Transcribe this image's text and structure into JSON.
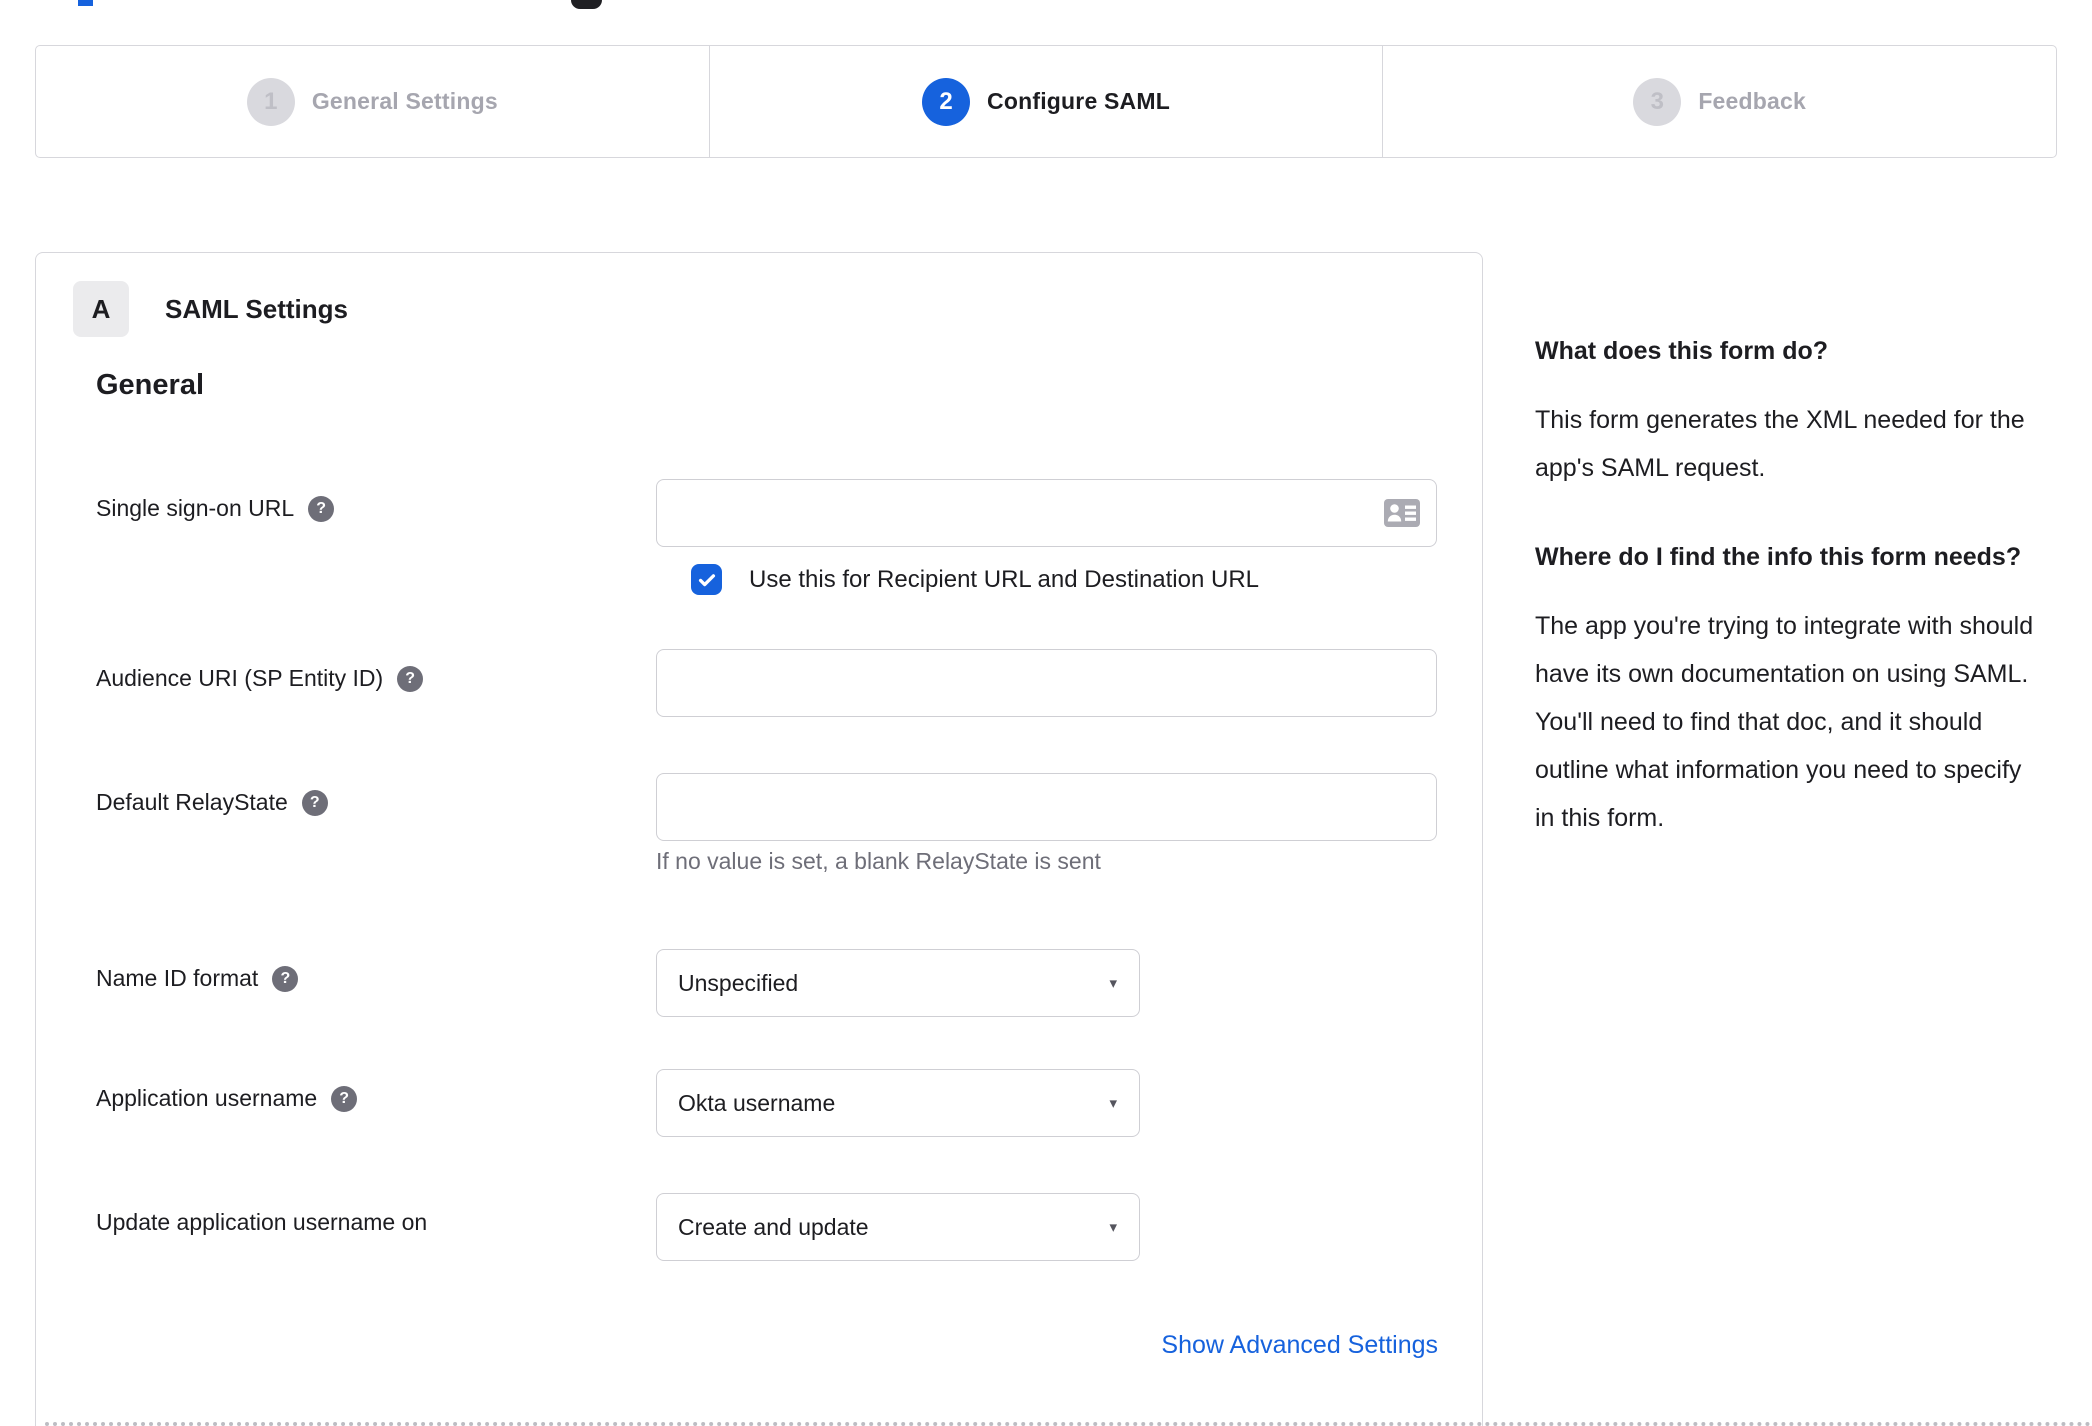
{
  "colors": {
    "accent_blue": "#1662dd",
    "text": "#1d1d21",
    "muted_gray": "#6e6e78",
    "border_gray": "#d7d7dc",
    "inactive_gray": "#a6a6af"
  },
  "icons": {
    "help": "?",
    "select_arrow": "▾"
  },
  "stepper": {
    "steps": [
      {
        "number": "1",
        "label": "General Settings",
        "state": "inactive"
      },
      {
        "number": "2",
        "label": "Configure SAML",
        "state": "active"
      },
      {
        "number": "3",
        "label": "Feedback",
        "state": "inactive"
      }
    ]
  },
  "panel": {
    "badge": "A",
    "title": "SAML Settings",
    "section_heading": "General",
    "fields": {
      "sso_url": {
        "label": "Single sign-on URL",
        "value": "",
        "checkbox_label": "Use this for Recipient URL and Destination URL",
        "checkbox_checked": true
      },
      "audience_uri": {
        "label": "Audience URI (SP Entity ID)",
        "value": ""
      },
      "default_relaystate": {
        "label": "Default RelayState",
        "value": "",
        "hint": "If no value is set, a blank RelayState is sent"
      },
      "name_id_format": {
        "label": "Name ID format",
        "value": "Unspecified"
      },
      "application_username": {
        "label": "Application username",
        "value": "Okta username"
      },
      "update_app_username": {
        "label": "Update application username on",
        "value": "Create and update"
      }
    },
    "advanced_link": "Show Advanced Settings"
  },
  "help": {
    "sections": [
      {
        "heading": "What does this form do?",
        "body": "This form generates the XML needed for the app's SAML request."
      },
      {
        "heading": "Where do I find the info this form needs?",
        "body": "The app you're trying to integrate with should have its own documentation on using SAML. You'll need to find that doc, and it should outline what information you need to specify in this form."
      }
    ]
  }
}
